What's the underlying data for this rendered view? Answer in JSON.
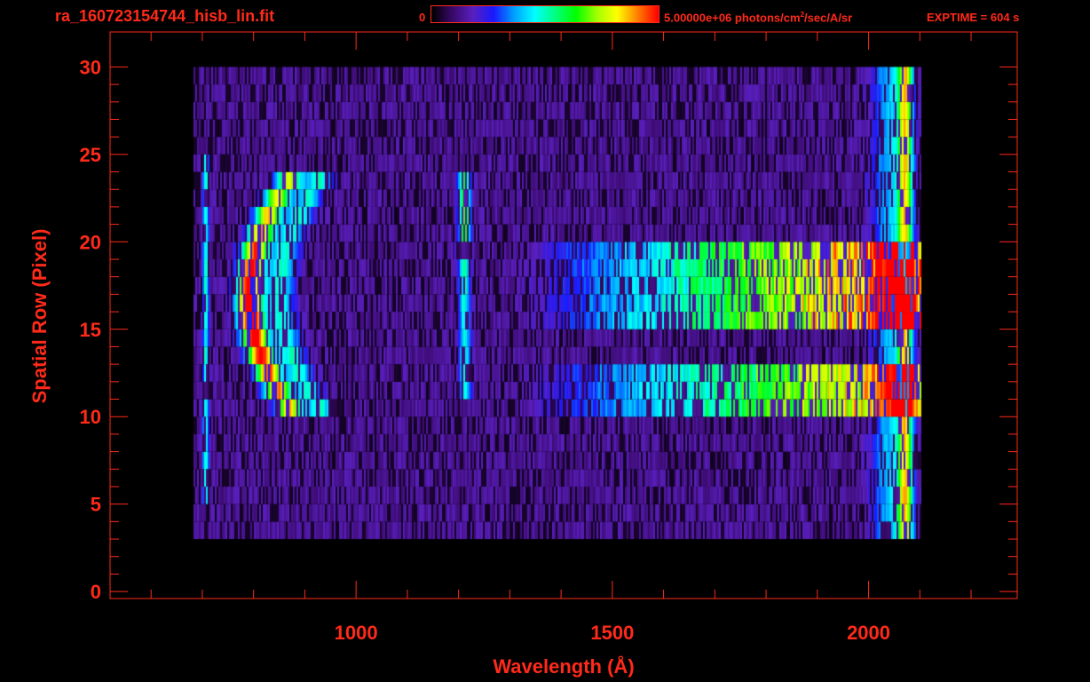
{
  "header": {
    "filename": "ra_160723154744_hisb_lin.fit",
    "colorbar_min": "0",
    "colorbar_max_prefix": "5.00000e+06 photons/cm",
    "colorbar_max_sup": "2",
    "colorbar_max_suffix": "/sec/A/sr",
    "exptime": "EXPTIME = 604 s"
  },
  "colors": {
    "axis": "#ff2a1a",
    "background": "#000000",
    "colormap": [
      "#000000",
      "#3a0a6a",
      "#5a20c0",
      "#1a1aff",
      "#00a0ff",
      "#00ffff",
      "#00ff80",
      "#00ff00",
      "#a0ff00",
      "#ffff00",
      "#ff8000",
      "#ff0000"
    ]
  },
  "chart_data": {
    "type": "heatmap",
    "xlabel": "Wavelength (Å)",
    "ylabel": "Spatial Row (Pixel)",
    "xlim": [
      520,
      2290
    ],
    "ylim": [
      -0.4,
      32
    ],
    "x_ticks_major": [
      1000,
      1500,
      2000
    ],
    "x_ticks_minor": [
      600,
      700,
      800,
      900,
      1100,
      1200,
      1300,
      1400,
      1600,
      1700,
      1800,
      1900,
      2100,
      2200
    ],
    "y_ticks_major": [
      0,
      5,
      10,
      15,
      20,
      25,
      30
    ],
    "y_ticks_minor": [
      1,
      2,
      3,
      4,
      6,
      7,
      8,
      9,
      11,
      12,
      13,
      14,
      16,
      17,
      18,
      19,
      21,
      22,
      23,
      24,
      26,
      27,
      28,
      29
    ],
    "grid": false,
    "colorbar_range": [
      0,
      5000000
    ],
    "data_extent": {
      "wavelength": [
        680,
        2100
      ],
      "rows": [
        3,
        30
      ]
    },
    "features": [
      {
        "label": "arc",
        "x": [
          780,
          960
        ],
        "rows": [
          10,
          24
        ],
        "peak_value": 0.95
      },
      {
        "label": "line",
        "x": 1210,
        "rows": [
          11,
          24
        ],
        "peak_value": 0.55
      },
      {
        "label": "band",
        "x": [
          1450,
          2070
        ],
        "rows": [
          15,
          20
        ],
        "peak_value": 0.85
      },
      {
        "label": "band",
        "x": [
          1450,
          2070
        ],
        "rows": [
          10,
          13
        ],
        "peak_value": 0.75
      },
      {
        "label": "edge",
        "x": 2070,
        "rows": [
          1,
          30
        ],
        "peak_value": 0.6
      },
      {
        "label": "edge",
        "x": 705,
        "rows": [
          5,
          25
        ],
        "peak_value": 0.35
      }
    ]
  }
}
